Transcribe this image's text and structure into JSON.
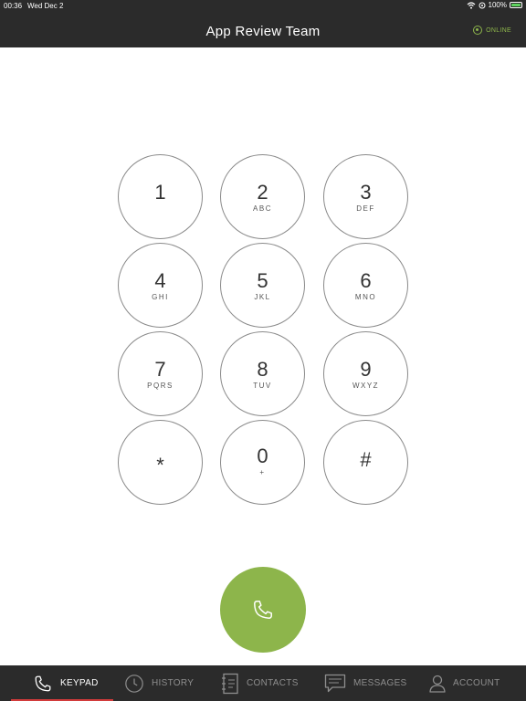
{
  "status_bar": {
    "time": "00:36",
    "date": "Wed Dec 2",
    "battery": "100%"
  },
  "header": {
    "title": "App Review Team",
    "status": "ONLINE"
  },
  "keypad": [
    {
      "digit": "1",
      "letters": ""
    },
    {
      "digit": "2",
      "letters": "ABC"
    },
    {
      "digit": "3",
      "letters": "DEF"
    },
    {
      "digit": "4",
      "letters": "GHI"
    },
    {
      "digit": "5",
      "letters": "JKL"
    },
    {
      "digit": "6",
      "letters": "MNO"
    },
    {
      "digit": "7",
      "letters": "PQRS"
    },
    {
      "digit": "8",
      "letters": "TUV"
    },
    {
      "digit": "9",
      "letters": "WXYZ"
    },
    {
      "digit": "*",
      "letters": ""
    },
    {
      "digit": "0",
      "letters": "+"
    },
    {
      "digit": "#",
      "letters": ""
    }
  ],
  "tabs": [
    {
      "label": "KEYPAD",
      "icon": "phone-icon",
      "active": true
    },
    {
      "label": "HISTORY",
      "icon": "clock-icon",
      "active": false
    },
    {
      "label": "CONTACTS",
      "icon": "address-book-icon",
      "active": false
    },
    {
      "label": "MESSAGES",
      "icon": "chat-icon",
      "active": false
    },
    {
      "label": "ACCOUNT",
      "icon": "user-icon",
      "active": false
    }
  ],
  "colors": {
    "accent_green": "#8db54b",
    "bar_dark": "#2b2b2b",
    "active_tab_underline": "#d23b3b"
  }
}
